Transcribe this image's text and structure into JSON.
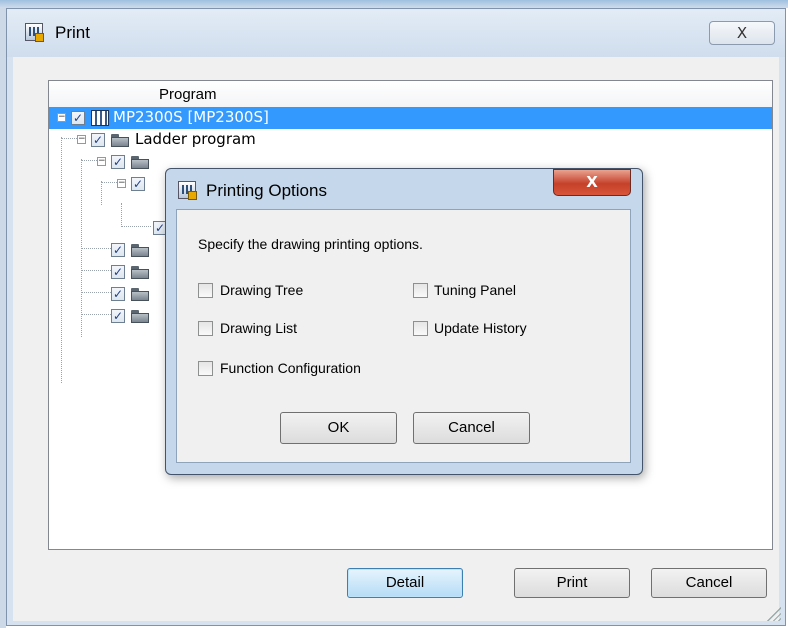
{
  "print_dialog": {
    "title": "Print",
    "close_glyph": "X",
    "column_header": "Program",
    "tree": {
      "root_label": "MP2300S [MP2300S]",
      "ladder_label": "Ladder program"
    },
    "buttons": {
      "detail": "Detail",
      "print": "Print",
      "cancel": "Cancel"
    }
  },
  "options_dialog": {
    "title": "Printing Options",
    "close_glyph": "X",
    "instruction": "Specify the drawing printing options.",
    "options": {
      "drawing_tree": "Drawing Tree",
      "tuning_panel": "Tuning Panel",
      "drawing_list": "Drawing List",
      "update_history": "Update History",
      "function_configuration": "Function Configuration"
    },
    "buttons": {
      "ok": "OK",
      "cancel": "Cancel"
    }
  },
  "check_glyph": "✓",
  "collapse_glyph": "−",
  "colors": {
    "selection": "#3399ff",
    "default_button": "#b5dcf6",
    "close_red": "#c54129"
  }
}
